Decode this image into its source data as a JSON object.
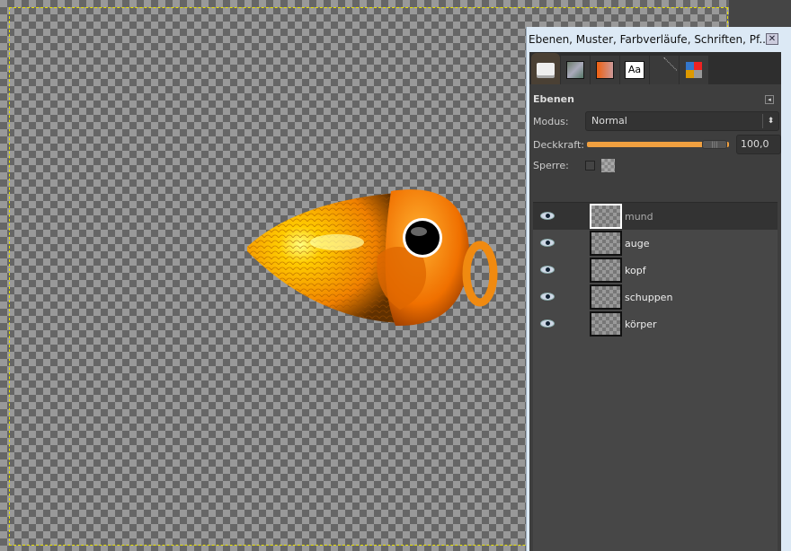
{
  "panel": {
    "title": "Ebenen, Muster, Farbverläufe, Schriften, Pf...",
    "tabs": [
      {
        "icon": "layers-icon"
      },
      {
        "icon": "patterns-icon"
      },
      {
        "icon": "gradients-icon"
      },
      {
        "icon": "fonts-icon",
        "label": "Aa"
      },
      {
        "icon": "paths-icon"
      },
      {
        "icon": "palettes-icon"
      }
    ],
    "heading": "Ebenen",
    "mode_label": "Modus:",
    "mode_value": "Normal",
    "opacity_label": "Deckkraft:",
    "opacity_value": "100,0",
    "opacity_percent": 100,
    "lock_label": "Sperre:",
    "layers": [
      {
        "name": "mund",
        "selected": true
      },
      {
        "name": "auge"
      },
      {
        "name": "kopf"
      },
      {
        "name": "schuppen"
      },
      {
        "name": "körper"
      }
    ]
  },
  "colors": {
    "accent": "#f0a040",
    "selection": "#e8e000"
  }
}
